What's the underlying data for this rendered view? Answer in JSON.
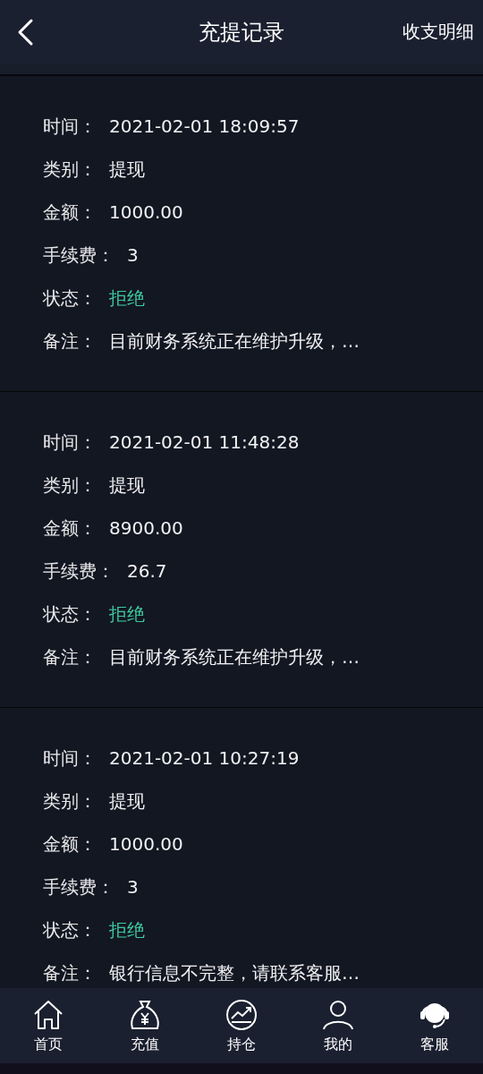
{
  "header": {
    "title": "充提记录",
    "action": "收支明细"
  },
  "records": [
    {
      "fields": [
        {
          "label": "时间：",
          "value": "2021-02-01 18:09:57",
          "kind": "text"
        },
        {
          "label": "类别：",
          "value": "提现",
          "kind": "text"
        },
        {
          "label": "金额：",
          "value": "1000.00",
          "kind": "text"
        },
        {
          "label": "手续费：",
          "value": "3",
          "kind": "text"
        },
        {
          "label": "状态：",
          "value": "拒绝",
          "kind": "status"
        },
        {
          "label": "备注：",
          "value": "目前财务系统正在维护升级，…",
          "kind": "text"
        }
      ]
    },
    {
      "fields": [
        {
          "label": "时间：",
          "value": "2021-02-01 11:48:28",
          "kind": "text"
        },
        {
          "label": "类别：",
          "value": "提现",
          "kind": "text"
        },
        {
          "label": "金额：",
          "value": "8900.00",
          "kind": "text"
        },
        {
          "label": "手续费：",
          "value": "26.7",
          "kind": "text"
        },
        {
          "label": "状态：",
          "value": "拒绝",
          "kind": "status"
        },
        {
          "label": "备注：",
          "value": "目前财务系统正在维护升级，…",
          "kind": "text"
        }
      ]
    },
    {
      "fields": [
        {
          "label": "时间：",
          "value": "2021-02-01 10:27:19",
          "kind": "text"
        },
        {
          "label": "类别：",
          "value": "提现",
          "kind": "text"
        },
        {
          "label": "金额：",
          "value": "1000.00",
          "kind": "text"
        },
        {
          "label": "手续费：",
          "value": "3",
          "kind": "text"
        },
        {
          "label": "状态：",
          "value": "拒绝",
          "kind": "status"
        },
        {
          "label": "备注：",
          "value": "银行信息不完整，请联系客服…",
          "kind": "text"
        }
      ]
    }
  ],
  "nav": [
    {
      "label": "首页",
      "kind": "home"
    },
    {
      "label": "充值",
      "kind": "moneybag"
    },
    {
      "label": "持仓",
      "kind": "chart"
    },
    {
      "label": "我的",
      "kind": "user"
    },
    {
      "label": "客服",
      "kind": "headset"
    }
  ]
}
